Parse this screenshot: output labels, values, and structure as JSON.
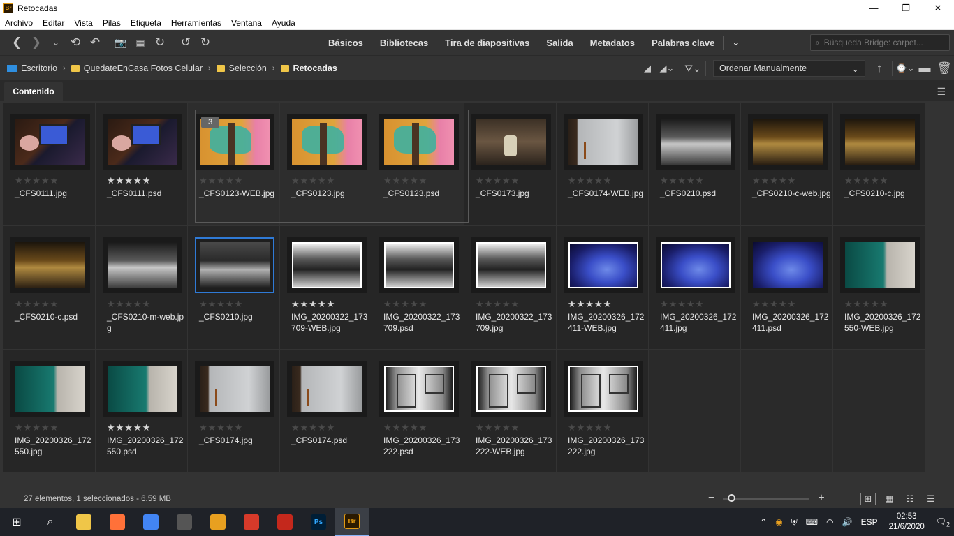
{
  "window": {
    "title": "Retocadas",
    "app_icon": "Br",
    "controls": [
      "—",
      "❐",
      "✕"
    ]
  },
  "menu": [
    "Archivo",
    "Editar",
    "Vista",
    "Pilas",
    "Etiqueta",
    "Herramientas",
    "Ventana",
    "Ayuda"
  ],
  "workspaces": [
    "Básicos",
    "Bibliotecas",
    "Tira de diapositivas",
    "Salida",
    "Metadatos",
    "Palabras clave"
  ],
  "search": {
    "placeholder": "Búsqueda Bridge: carpet..."
  },
  "path": [
    {
      "label": "Escritorio",
      "icon": "desktop-icon"
    },
    {
      "label": "QuedateEnCasa Fotos Celular",
      "icon": "folder-icon"
    },
    {
      "label": "Selección",
      "icon": "folder-icon"
    },
    {
      "label": "Retocadas",
      "icon": "folder-icon"
    }
  ],
  "sort": {
    "value": "Ordenar Manualmente"
  },
  "panel": {
    "tab": "Contenido"
  },
  "stack": {
    "count": "3"
  },
  "items": [
    {
      "name": "_CFS0111.jpg",
      "rated": false,
      "img": "img-laptop"
    },
    {
      "name": "_CFS0111.psd",
      "rated": true,
      "img": "img-laptop"
    },
    {
      "name": "_CFS0123-WEB.jpg",
      "rated": false,
      "img": "img-cactus",
      "stack": true
    },
    {
      "name": "_CFS0123.jpg",
      "rated": false,
      "img": "img-cactus",
      "stack": true
    },
    {
      "name": "_CFS0123.psd",
      "rated": false,
      "img": "img-cactus",
      "stack": true
    },
    {
      "name": "_CFS0173.jpg",
      "rated": false,
      "img": "img-bar"
    },
    {
      "name": "_CFS0174-WEB.jpg",
      "rated": false,
      "img": "img-wall"
    },
    {
      "name": "_CFS0210.psd",
      "rated": false,
      "img": "img-bw-bottles"
    },
    {
      "name": "_CFS0210-c-web.jpg",
      "rated": false,
      "img": "img-bottles"
    },
    {
      "name": "_CFS0210-c.jpg",
      "rated": false,
      "img": "img-bottles"
    },
    {
      "name": "_CFS0210-c.psd",
      "rated": false,
      "img": "img-bottles"
    },
    {
      "name": "_CFS0210-m-web.jpg",
      "rated": false,
      "img": "img-bw-bottles"
    },
    {
      "name": "_CFS0210.jpg",
      "rated": false,
      "img": "img-bw-dark",
      "selected": true
    },
    {
      "name": "IMG_20200322_173709-WEB.jpg",
      "rated": true,
      "img": "img-bw-girl"
    },
    {
      "name": "IMG_20200322_173709.psd",
      "rated": false,
      "img": "img-bw-girl"
    },
    {
      "name": "IMG_20200322_173709.jpg",
      "rated": false,
      "img": "img-bw-girl"
    },
    {
      "name": "IMG_20200326_172411-WEB.jpg",
      "rated": true,
      "img": "img-blue"
    },
    {
      "name": "IMG_20200326_172411.jpg",
      "rated": false,
      "img": "img-blue"
    },
    {
      "name": "IMG_20200326_172411.psd",
      "rated": false,
      "img": "img-blue-nb"
    },
    {
      "name": "IMG_20200326_172550-WEB.jpg",
      "rated": false,
      "img": "img-teal"
    },
    {
      "name": "IMG_20200326_172550.jpg",
      "rated": false,
      "img": "img-teal"
    },
    {
      "name": "IMG_20200326_172550.psd",
      "rated": true,
      "img": "img-teal"
    },
    {
      "name": "_CFS0174.jpg",
      "rated": false,
      "img": "img-wall"
    },
    {
      "name": "_CFS0174.psd",
      "rated": false,
      "img": "img-wall"
    },
    {
      "name": "IMG_20200326_173222.psd",
      "rated": false,
      "img": "img-door"
    },
    {
      "name": "IMG_20200326_173222-WEB.jpg",
      "rated": false,
      "img": "img-door"
    },
    {
      "name": "IMG_20200326_173222.jpg",
      "rated": false,
      "img": "img-door"
    }
  ],
  "status": {
    "text": "27 elementos, 1 seleccionados - 6.59 MB",
    "zoom_level": 0.05
  },
  "taskbar": {
    "apps": [
      {
        "name": "file-explorer",
        "color": "#f0c648",
        "label": ""
      },
      {
        "name": "firefox",
        "color": "#ff7139",
        "label": ""
      },
      {
        "name": "chrome",
        "color": "#4285f4",
        "label": ""
      },
      {
        "name": "calculator",
        "color": "#555555",
        "label": ""
      },
      {
        "name": "search-app",
        "color": "#e8a020",
        "label": ""
      },
      {
        "name": "ccleaner",
        "color": "#d63a2a",
        "label": ""
      },
      {
        "name": "acrobat",
        "color": "#c4281c",
        "label": ""
      },
      {
        "name": "photoshop",
        "color": "#001e36",
        "label": "Ps"
      },
      {
        "name": "bridge",
        "color": "#2b1a00",
        "label": "Br"
      }
    ],
    "lang": "ESP",
    "time": "02:53",
    "date": "21/6/2020",
    "notifications": "2"
  },
  "colors": {
    "accent": "#2f7ad6",
    "bridge": "#e39a12"
  }
}
